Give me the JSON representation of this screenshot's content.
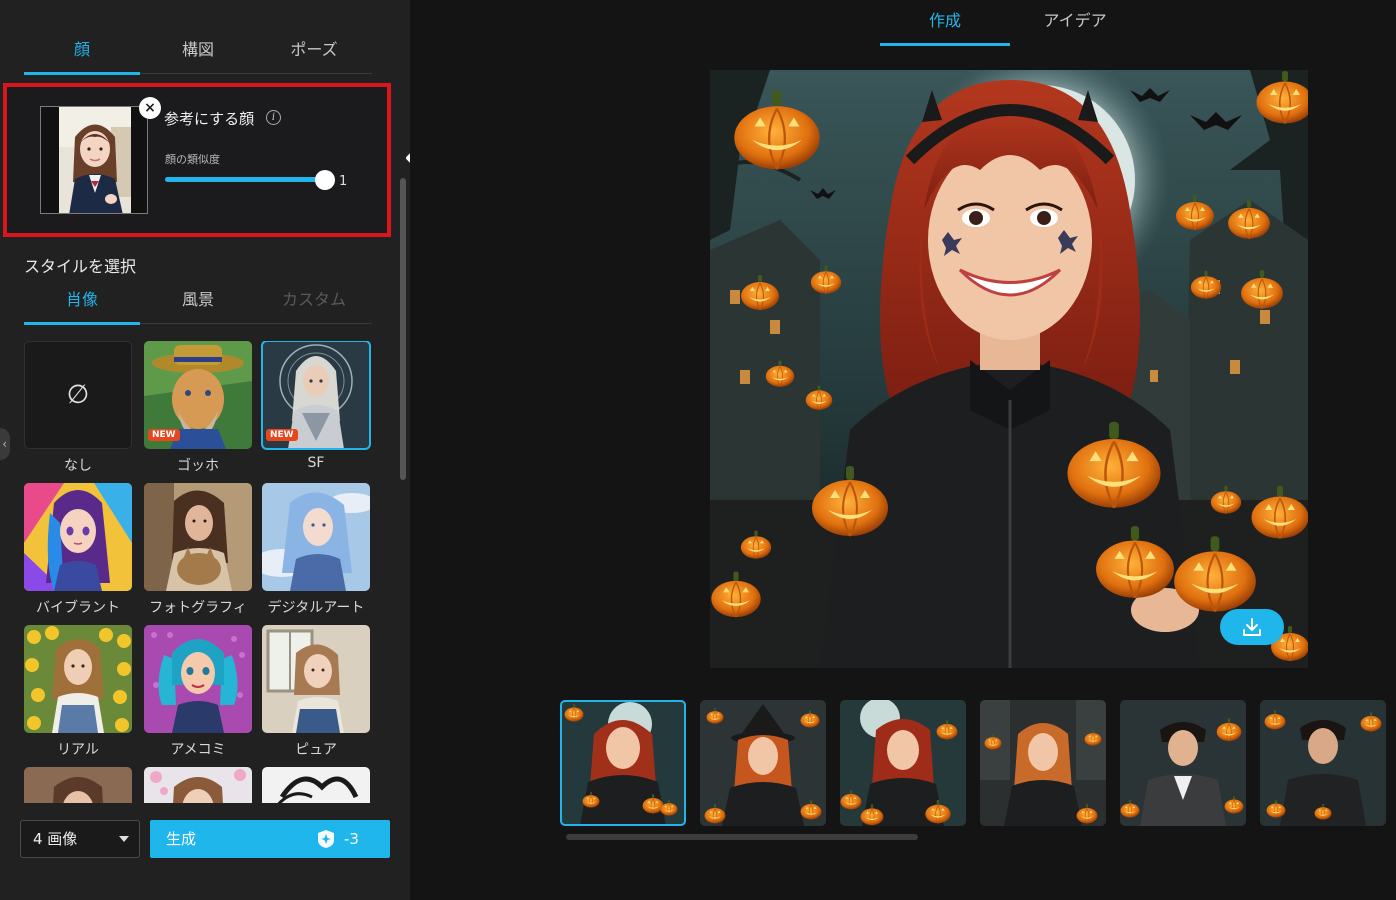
{
  "left": {
    "top_tabs": [
      {
        "label": "顔",
        "active": true
      },
      {
        "label": "構図",
        "active": false
      },
      {
        "label": "ポーズ",
        "active": false
      }
    ],
    "reference_face": {
      "title": "参考にする顔",
      "info_icon": "info-icon",
      "remove_icon": "close-icon",
      "remove_symbol": "×",
      "similarity_label": "顔の類似度",
      "similarity_value": "1",
      "similarity_fraction": 1.0
    },
    "style_section_title": "スタイルを選択",
    "style_tabs": [
      {
        "label": "肖像",
        "active": true,
        "disabled": false
      },
      {
        "label": "風景",
        "active": false,
        "disabled": false
      },
      {
        "label": "カスタム",
        "active": false,
        "disabled": true
      }
    ],
    "styles": [
      {
        "label": "なし",
        "symbol": "∅",
        "badge": "",
        "selected": false
      },
      {
        "label": "ゴッホ",
        "badge": "NEW",
        "selected": false
      },
      {
        "label": "SF",
        "badge": "NEW",
        "selected": true
      },
      {
        "label": "バイブラント",
        "badge": "",
        "selected": false
      },
      {
        "label": "フォトグラフィ",
        "badge": "",
        "selected": false
      },
      {
        "label": "デジタルアート",
        "badge": "",
        "selected": false
      },
      {
        "label": "リアル",
        "badge": "",
        "selected": false
      },
      {
        "label": "アメコミ",
        "badge": "",
        "selected": false
      },
      {
        "label": "ピュア",
        "badge": "",
        "selected": false
      }
    ],
    "collapse_icon": "chevron-left-icon",
    "collapse_symbol": "‹",
    "image_count": "4 画像",
    "generate_label": "生成",
    "generate_cost": "-3",
    "accent": "#22b5ea",
    "highlight_border": "#d8161c"
  },
  "right": {
    "main_tabs": [
      {
        "label": "作成",
        "active": true
      },
      {
        "label": "アイデア",
        "active": false
      }
    ],
    "download_icon": "download-icon",
    "results_count": 6,
    "selected_result": 0
  }
}
